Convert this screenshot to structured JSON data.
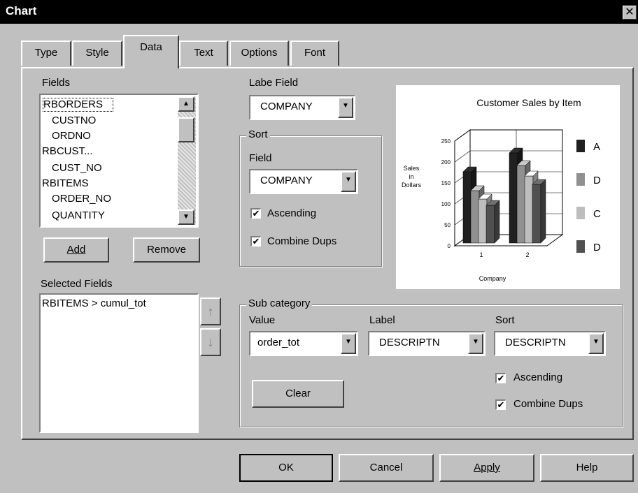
{
  "window": {
    "title": "Chart",
    "close_glyph": "✕"
  },
  "tabs": [
    {
      "label": "Type"
    },
    {
      "label": "Style"
    },
    {
      "label": "Data",
      "active": true
    },
    {
      "label": "Text"
    },
    {
      "label": "Options"
    },
    {
      "label": "Font"
    }
  ],
  "fields": {
    "label": "Fields",
    "items": [
      "RBORDERS",
      "CUSTNO",
      "ORDNO",
      "RBCUST...",
      "CUST_NO",
      "RBITEMS",
      "ORDER_NO",
      "QUANTITY"
    ],
    "add_button": "Add",
    "remove_button": "Remove"
  },
  "selected_fields": {
    "label": "Selected Fields",
    "items": [
      "RBITEMS > cumul_tot"
    ],
    "up_glyph": "↑",
    "down_glyph": "↓"
  },
  "label_field": {
    "label": "Labe Field",
    "value": "COMPANY"
  },
  "sort": {
    "group_title": "Sort",
    "field_label": "Field",
    "field_value": "COMPANY",
    "ascending_label": "Ascending",
    "ascending_checked": true,
    "combine_dups_label": "Combine Dups",
    "combine_dups_checked": true
  },
  "preview": {
    "title": "Customer Sales by Item",
    "ylabel": [
      "Sales",
      "in",
      "Dollars"
    ],
    "xlabel": "Company",
    "legend": [
      {
        "label": "A",
        "color": "#202020"
      },
      {
        "label": "D",
        "color": "#909090"
      },
      {
        "label": "C",
        "color": "#bdbdbd"
      },
      {
        "label": "D",
        "color": "#505050"
      }
    ]
  },
  "chart_data": {
    "type": "bar",
    "title": "Customer Sales by Item",
    "xlabel": "Company",
    "ylabel": "Sales in Dollars",
    "categories": [
      "1",
      "2"
    ],
    "y_ticks": [
      "250",
      "200",
      "150",
      "100",
      "50",
      "0"
    ],
    "ylim": [
      0,
      250
    ],
    "series": [
      {
        "name": "A",
        "values": [
          170,
          215
        ]
      },
      {
        "name": "D",
        "values": [
          125,
          185
        ]
      },
      {
        "name": "C",
        "values": [
          105,
          160
        ]
      },
      {
        "name": "D",
        "values": [
          90,
          140
        ]
      }
    ]
  },
  "subcategory": {
    "group_title": "Sub category",
    "value_label": "Value",
    "value_selected": "order_tot",
    "label_label": "Label",
    "label_selected": "DESCRIPTN",
    "sort_label": "Sort",
    "sort_selected": "DESCRIPTN",
    "ascending_label": "Ascending",
    "ascending_checked": true,
    "combine_dups_label": "Combine Dups",
    "combine_dups_checked": true,
    "clear_button": "Clear"
  },
  "footer": {
    "ok": "OK",
    "cancel": "Cancel",
    "apply": "Apply",
    "help": "Help"
  },
  "glyphs": {
    "down_arrow": "▼",
    "up_arrow": "▲",
    "check": "✔"
  }
}
